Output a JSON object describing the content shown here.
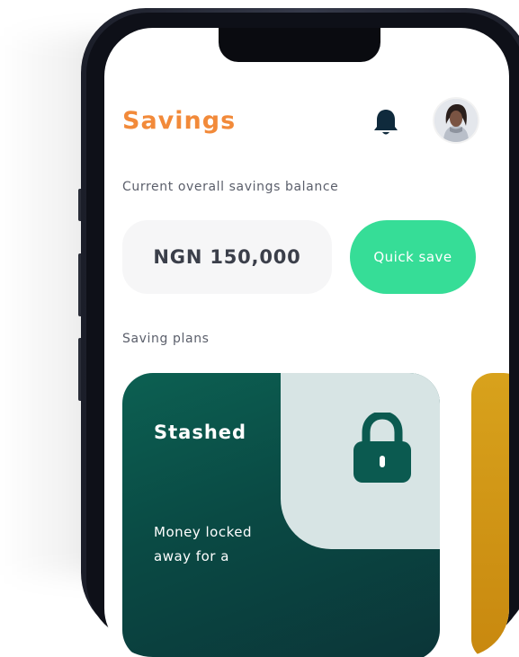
{
  "header": {
    "title": "Savings",
    "icons": {
      "notification": "bell-icon",
      "profile": "avatar"
    }
  },
  "balance": {
    "label": "Current overall savings balance",
    "amount": "NGN 150,000"
  },
  "quick_save": {
    "label": "Quick save"
  },
  "plans": {
    "label": "Saving plans",
    "items": [
      {
        "title": "Stashed",
        "description": "Money locked away for a",
        "icon": "lock-icon",
        "colors": {
          "background": "#0a4a44",
          "panel": "#d7e4e4",
          "icon": "#0b5a50"
        }
      }
    ]
  },
  "colors": {
    "accent": "#f28a3a",
    "quick_save": "#36dd97",
    "second_plan": "#d8a21c"
  }
}
